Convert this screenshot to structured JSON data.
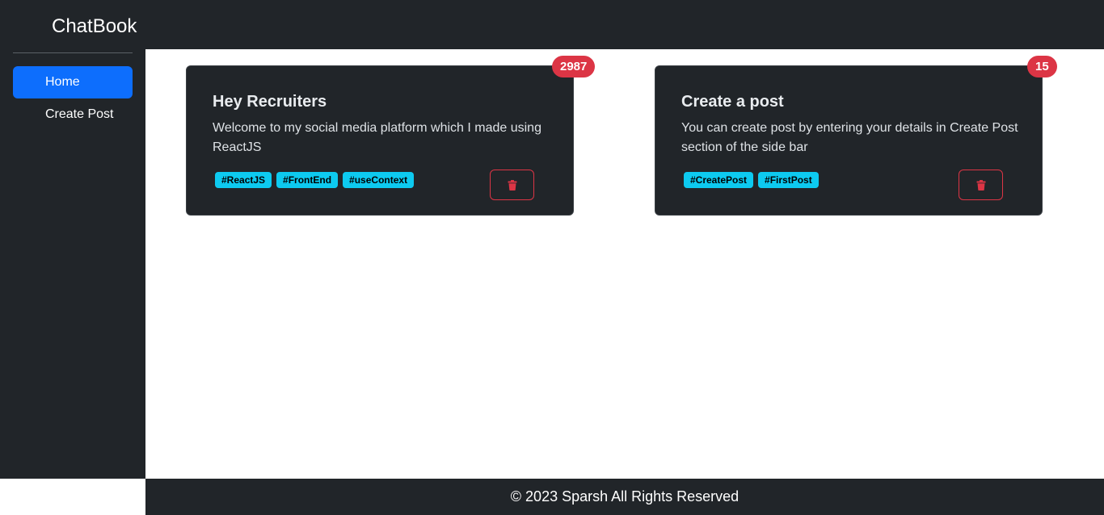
{
  "header": {
    "brand": "ChatBook"
  },
  "sidebar": {
    "items": [
      {
        "label": "Home",
        "active": true
      },
      {
        "label": "Create Post",
        "active": false
      }
    ]
  },
  "posts": [
    {
      "title": "Hey Recruiters",
      "body": "Welcome to my social media platform which I made using ReactJS",
      "reactions": "2987",
      "tags": [
        "#ReactJS",
        "#FrontEnd",
        "#useContext"
      ],
      "delete_icon": "trash-icon"
    },
    {
      "title": "Create a post",
      "body": "You can create post by entering your details in Create Post section of the side bar",
      "reactions": "15",
      "tags": [
        "#CreatePost",
        "#FirstPost"
      ],
      "delete_icon": "trash-icon"
    }
  ],
  "footer": {
    "text": "© 2023 Sparsh All Rights Reserved"
  },
  "colors": {
    "dark": "#212529",
    "primary": "#0d6efd",
    "danger": "#dc3545",
    "info": "#0dcaf0"
  }
}
